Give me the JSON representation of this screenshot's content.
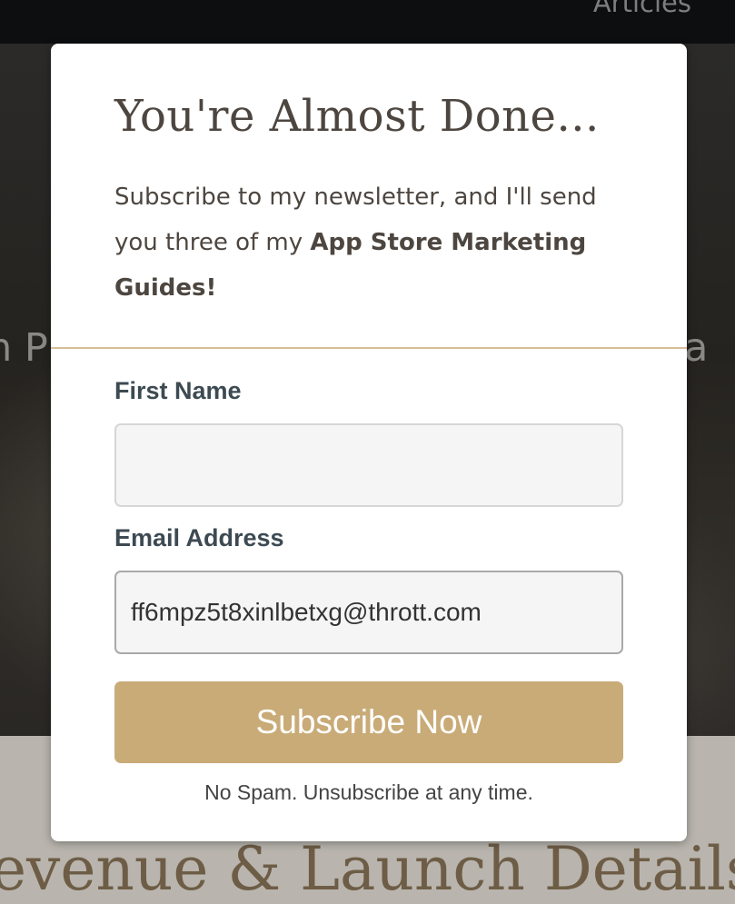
{
  "background": {
    "nav_link": "Articles",
    "hero_left_text": "n Pr",
    "hero_right_text": "g a",
    "lower_heading": "evenue & Launch Details"
  },
  "modal": {
    "title": "You're Almost Done...",
    "description_prefix": "Subscribe to my newsletter, and I'll send you three of my ",
    "description_bold": "App Store Marketing Guides!",
    "first_name_label": "First Name",
    "first_name_value": "",
    "email_label": "Email Address",
    "email_value": "ff6mpz5t8xinlbetxg@thrott.com",
    "submit_label": "Subscribe Now",
    "fine_print": "No Spam. Unsubscribe at any time."
  },
  "colors": {
    "accent": "#c9ab78",
    "divider": "#d6be96",
    "title_text": "#4d4640",
    "label_text": "#3d4a52"
  }
}
